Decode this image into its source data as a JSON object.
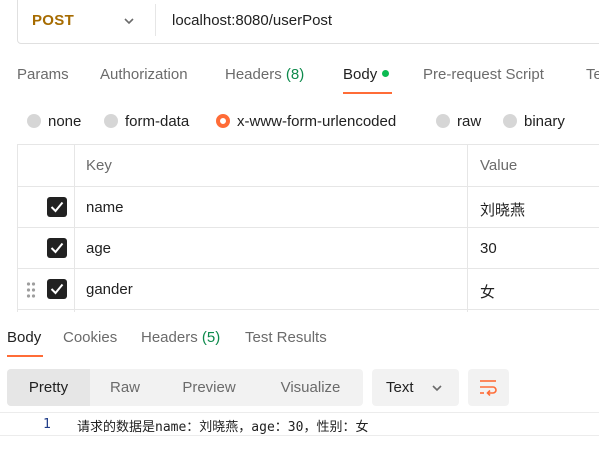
{
  "request": {
    "method": "POST",
    "url": "localhost:8080/userPost"
  },
  "request_tabs": [
    {
      "label": "Params"
    },
    {
      "label": "Authorization"
    },
    {
      "label": "Headers",
      "count": "(8)"
    },
    {
      "label": "Body",
      "active": true
    },
    {
      "label": "Pre-request Script"
    },
    {
      "label": "Te"
    }
  ],
  "body_types": [
    {
      "label": "none",
      "selected": false
    },
    {
      "label": "form-data",
      "selected": false
    },
    {
      "label": "x-www-form-urlencoded",
      "selected": true
    },
    {
      "label": "raw",
      "selected": false
    },
    {
      "label": "binary",
      "selected": false
    }
  ],
  "params_table": {
    "headers": {
      "key": "Key",
      "value": "Value"
    },
    "rows": [
      {
        "key": "name",
        "value": "刘晓燕",
        "checked": true
      },
      {
        "key": "age",
        "value": "30",
        "checked": true
      },
      {
        "key": "gander",
        "value": "女",
        "checked": true
      }
    ]
  },
  "response_tabs": [
    {
      "label": "Body",
      "active": true
    },
    {
      "label": "Cookies"
    },
    {
      "label": "Headers",
      "count": "(5)"
    },
    {
      "label": "Test Results"
    }
  ],
  "view_modes": [
    "Pretty",
    "Raw",
    "Preview",
    "Visualize"
  ],
  "active_view": "Pretty",
  "format": "Text",
  "response_body": {
    "line_number": "1",
    "text": "请求的数据是name：刘晓燕，age：30，性别：女"
  },
  "colors": {
    "accent": "#ff6c37",
    "method": "#a66b00",
    "count": "#0e8a4c",
    "body_dot": "#0cbb52"
  }
}
